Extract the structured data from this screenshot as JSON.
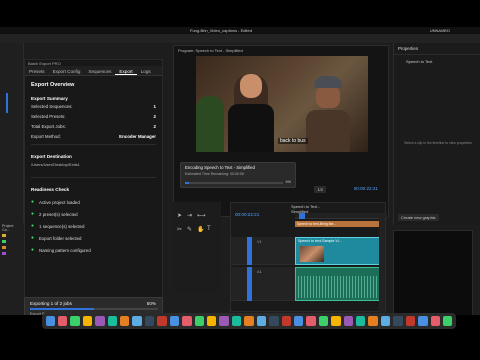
{
  "window": {
    "title": "Fung-Brin_Video_captions - Edited",
    "menu_right": "UNNAMED"
  },
  "plugin": {
    "header": "Batch Export PRO",
    "tabs": [
      "Presets",
      "Export Config",
      "Sequences",
      "Export",
      "Logs"
    ],
    "active_tab": "Export",
    "overview_title": "Export Overview",
    "summary_title": "Export Summary",
    "summary_rows": [
      {
        "label": "Selected Sequences:",
        "value": "1"
      },
      {
        "label": "Selected Presets:",
        "value": "2"
      },
      {
        "label": "Total Export Jobs:",
        "value": "2"
      },
      {
        "label": "Export Method:",
        "value": "Encoder Manager"
      }
    ],
    "destination_title": "Export Destination",
    "destination_path": "/Users/User/Desktop/Exits1",
    "readiness_title": "Readiness Check",
    "checks": [
      "Active project loaded",
      "2 preset(s) selected",
      "1 sequence(s) selected",
      "Export folder selected",
      "Naming pattern configured"
    ],
    "exporting_label": "Exporting 1 of 2 jobs",
    "exporting_percent": "50%",
    "exporting_progress": 0.5,
    "export_progress_label": "Export Progress",
    "current_label": "Current:"
  },
  "preview": {
    "title": "Program: Speech to Text - Simplified",
    "caption": "back to bus",
    "encoding_title": "Encoding Speech to Text - Simplified",
    "encoding_estimate": "Estimated Time Remaining: 00:00:05",
    "encoding_percent": "4%",
    "encoding_progress": 0.04,
    "cancel_label": "Cancel",
    "timecode": "00:00:22:21",
    "fit_label": "1/2"
  },
  "properties": {
    "header": "Properties",
    "item": "Speech to Text",
    "empty_message": "Select a clip in the timeline to view properties",
    "create_button": "Create new graphic"
  },
  "timeline": {
    "tab_label": "Speech to Text - Simplified",
    "timecode": "00:00:22:21",
    "caption_track_text": "Speech to text-Bring Me...",
    "video_clip_name": "Speech to text-Sample-Vi...",
    "track_labels": [
      "V1",
      "A1"
    ],
    "subtitles_label": "Subtitles"
  },
  "project": {
    "header": "Project: Ca...",
    "items": [
      "",
      "",
      "",
      ""
    ]
  },
  "dock": {
    "apps": [
      "Finder",
      "Launchpad",
      "Safari",
      "Messages",
      "Mail",
      "Maps",
      "Photos",
      "FaceTime",
      "Calendar",
      "Contacts",
      "Reminders",
      "Notes",
      "TV",
      "Music",
      "Podcasts",
      "App Store",
      "Settings",
      "Chrome",
      "Slack",
      "Notion",
      "Discord",
      "Spotify",
      "Terminal",
      "VS Code",
      "Pr",
      "Ae",
      "Ps",
      "Ai",
      "Me",
      "Au",
      "Ps",
      "Downloads",
      "Trash"
    ]
  },
  "colors": {
    "accent": "#2f73d9",
    "success": "#3ccf6a",
    "caption_track": "#b8733a",
    "video_clip": "#1f8a9e",
    "audio_clip": "#1c6e58"
  }
}
